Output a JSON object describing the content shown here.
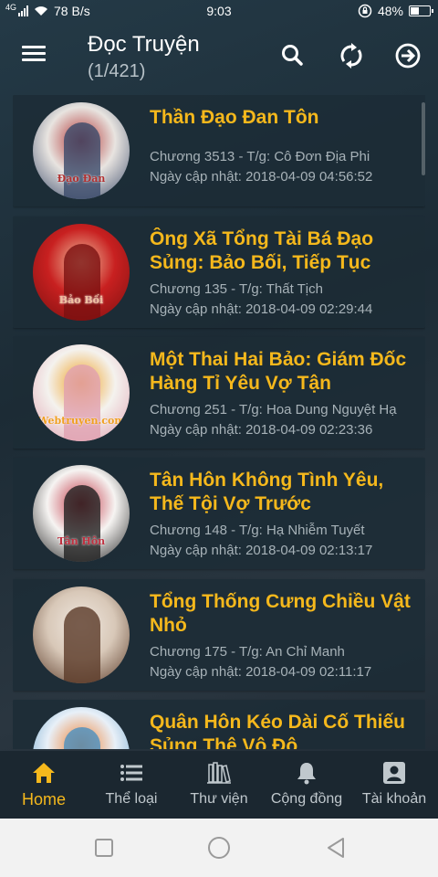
{
  "status_bar": {
    "network_type": "4G",
    "speed": "78 B/s",
    "time": "9:03",
    "battery": "48%",
    "battery_level": 0.48
  },
  "app_bar": {
    "title": "Đọc Truyện",
    "page_counter": "(1/421)",
    "icons": [
      "menu-icon",
      "search-icon",
      "refresh-icon",
      "arrow-right-circle-icon"
    ]
  },
  "stories": [
    {
      "title": "Thần Đạo Đan Tôn",
      "chapter": "Chương 3513 - T/g: Cô Đơn Địa Phi",
      "updated": "Ngày cập nhật: 2018-04-09 04:56:52",
      "cover_text": "Đạo Đan",
      "cover_colors": [
        "#e8e4e0",
        "#3a4a6a",
        "#b03030"
      ]
    },
    {
      "title": "Ông Xã Tổng Tài Bá Đạo Sủng: Bảo Bối, Tiếp Tục",
      "chapter": "Chương 135 - T/g: Thất Tịch",
      "updated": "Ngày cập nhật: 2018-04-09 02:29:44",
      "cover_text": "Bảo Bối",
      "cover_colors": [
        "#c82020",
        "#7a1010",
        "#f0c0a0"
      ]
    },
    {
      "title": "Một Thai Hai Bảo: Giám Đốc Hàng Tỉ Yêu Vợ Tận",
      "chapter": "Chương 251 - T/g: Hoa Dung Nguyệt Hạ",
      "updated": "Ngày cập nhật: 2018-04-09 02:23:36",
      "cover_text": "Webtruyen.com",
      "cover_colors": [
        "#f4f2ee",
        "#e0a0b0",
        "#f0a020"
      ]
    },
    {
      "title": "Tân Hôn Không Tình Yêu, Thế Tội Vợ Trước",
      "chapter": "Chương 148 - T/g: Hạ Nhiễm Tuyết",
      "updated": "Ngày cập nhật: 2018-04-09 02:13:17",
      "cover_text": "Tân Hôn",
      "cover_colors": [
        "#f6f4f2",
        "#202020",
        "#c03040"
      ]
    },
    {
      "title": "Tổng Thống Cưng Chiều Vật Nhỏ",
      "chapter": "Chương 175 - T/g: An Chỉ Manh",
      "updated": "Ngày cập nhật: 2018-04-09 02:11:17",
      "cover_text": "",
      "cover_colors": [
        "#d8c8b8",
        "#5a3a28",
        "#f0e8e0"
      ]
    },
    {
      "title": "Quân Hôn Kéo Dài Cố Thiếu Sủng Thê Vô Độ",
      "chapter": "",
      "updated": "",
      "cover_text": "",
      "cover_colors": [
        "#e8f0f8",
        "#4a90c0",
        "#f08030"
      ]
    }
  ],
  "bottom_nav": {
    "items": [
      {
        "label": "Home",
        "icon": "home-icon",
        "active": true
      },
      {
        "label": "Thể loại",
        "icon": "list-icon",
        "active": false
      },
      {
        "label": "Thư viện",
        "icon": "library-icon",
        "active": false
      },
      {
        "label": "Cộng đồng",
        "icon": "bell-icon",
        "active": false
      },
      {
        "label": "Tài khoản",
        "icon": "account-icon",
        "active": false
      }
    ]
  },
  "system_nav": {
    "icons": [
      "recents-icon",
      "home-circle-icon",
      "back-icon"
    ]
  },
  "colors": {
    "accent": "#f5b81c",
    "background": "#1d2a33",
    "card": "#1c2c36",
    "meta_text": "#a7b2b8"
  }
}
